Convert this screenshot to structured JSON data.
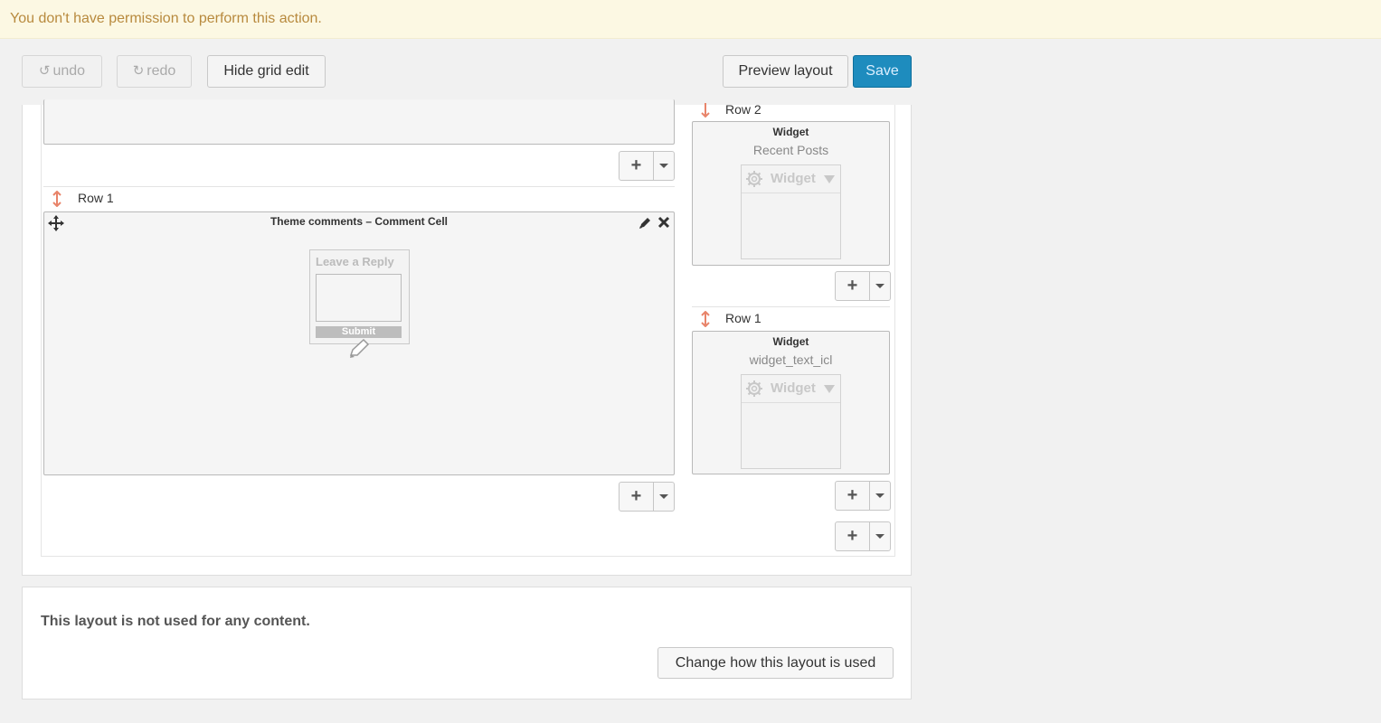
{
  "notice": {
    "text": "You don't have permission to perform this action."
  },
  "toolbar": {
    "undo_label": "undo",
    "redo_label": "redo",
    "hide_grid_label": "Hide grid edit",
    "preview_label": "Preview layout",
    "save_label": "Save"
  },
  "left_column": {
    "row1_label": "Row 1",
    "comment_cell": {
      "title": "Theme comments – Comment Cell",
      "preview_heading": "Leave a Reply",
      "preview_submit": "Submit"
    }
  },
  "right_column": {
    "row2": {
      "label": "Row 2",
      "title": "Widget",
      "subtitle": "Recent Posts",
      "preview_label": "Widget"
    },
    "row1": {
      "label": "Row 1",
      "title": "Widget",
      "subtitle": "widget_text_icl",
      "preview_label": "Widget"
    }
  },
  "usage": {
    "text": "This layout is not used for any content.",
    "button_label": "Change how this layout is used"
  },
  "colors": {
    "notice_bg": "#fcf8e3",
    "notice_text": "#b88a3e",
    "save_button": "#1e8cbe",
    "row_arrow": "#e8846a"
  }
}
